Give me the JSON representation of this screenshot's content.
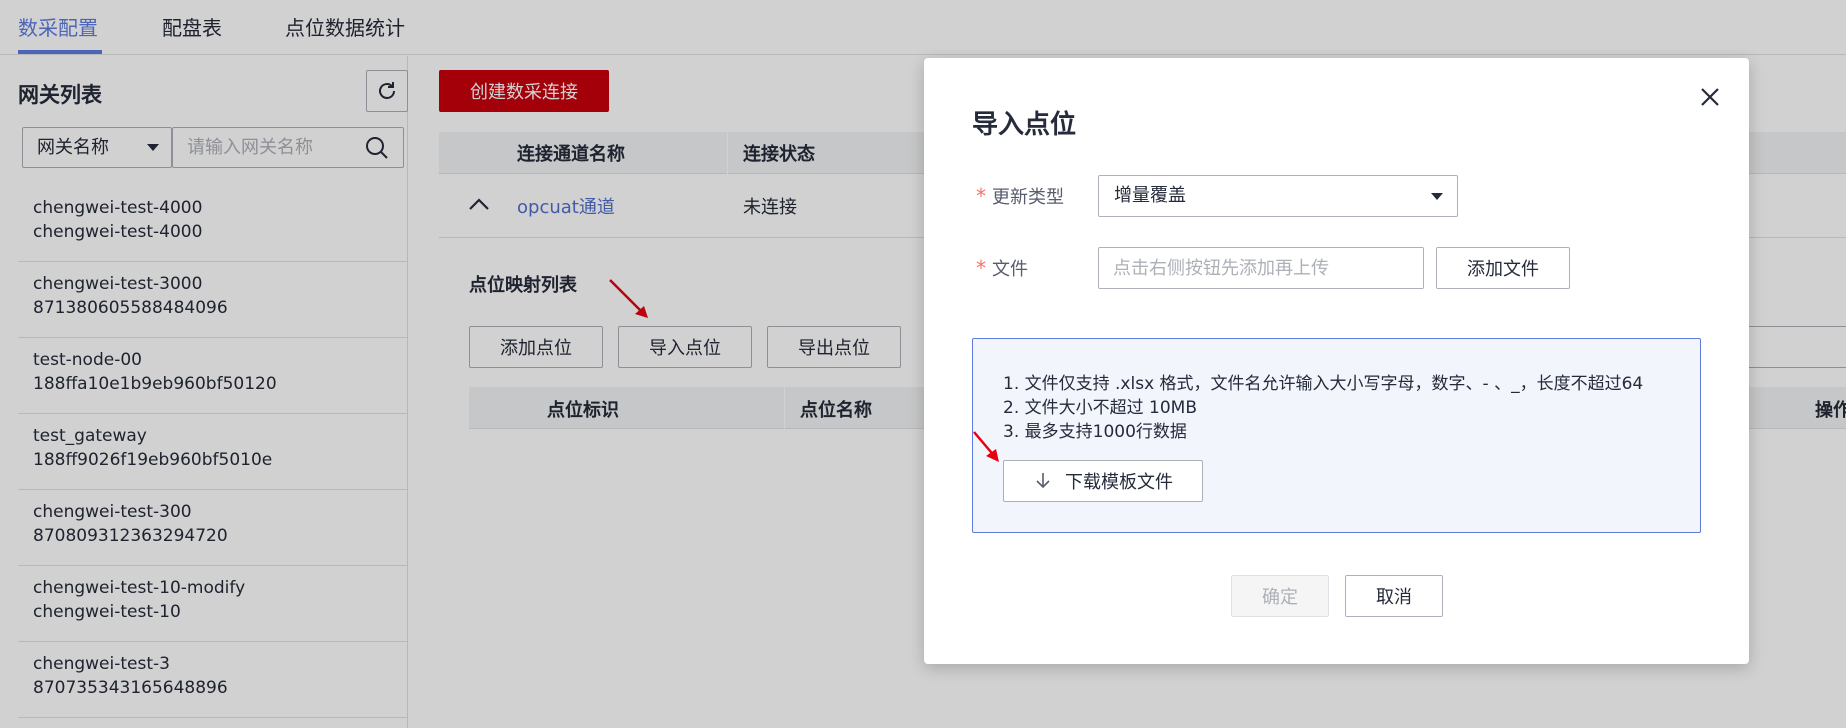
{
  "top_tabs": [
    {
      "label": "数采配置",
      "active": true
    },
    {
      "label": "配盘表",
      "active": false
    },
    {
      "label": "点位数据统计",
      "active": false
    }
  ],
  "left_panel": {
    "title": "网关列表",
    "filter_field": "网关名称",
    "search_placeholder": "请输入网关名称",
    "gateways": [
      {
        "name": "chengwei-test-4000",
        "id": "chengwei-test-4000"
      },
      {
        "name": "chengwei-test-3000",
        "id": "871380605588484096"
      },
      {
        "name": "test-node-00",
        "id": "188ffa10e1b9eb960bf50120"
      },
      {
        "name": "test_gateway",
        "id": "188ff9026f19eb960bf5010e"
      },
      {
        "name": "chengwei-test-300",
        "id": "870809312363294720"
      },
      {
        "name": "chengwei-test-10-modify",
        "id": "chengwei-test-10"
      },
      {
        "name": "chengwei-test-3",
        "id": "870735343165648896"
      }
    ]
  },
  "main": {
    "create_button": "创建数采连接",
    "columns": [
      "连接通道名称",
      "连接状态"
    ],
    "row": {
      "channel": "opcuat通道",
      "status": "未连接"
    },
    "mapping_title": "点位映射列表",
    "buttons": {
      "add": "添加点位",
      "import": "导入点位",
      "export": "导出点位"
    },
    "mapping_columns": [
      "点位标识",
      "点位名称",
      "操作"
    ]
  },
  "modal": {
    "title": "导入点位",
    "update_type_label": "更新类型",
    "update_type_value": "增量覆盖",
    "file_label": "文件",
    "file_placeholder": "点击右侧按钮先添加再上传",
    "add_file_button": "添加文件",
    "tips": [
      "1. 文件仅支持 .xlsx 格式，文件名允许输入大小写字母，数字、- 、_，长度不超过64",
      "2. 文件大小不超过 10MB",
      "3. 最多支持1000行数据"
    ],
    "download_button": "下载模板文件",
    "confirm_button": "确定",
    "cancel_button": "取消"
  },
  "colors": {
    "brand": "#c7000b",
    "accent": "#5e7ce0",
    "link": "#526ecc",
    "required": "#f66f6a"
  }
}
